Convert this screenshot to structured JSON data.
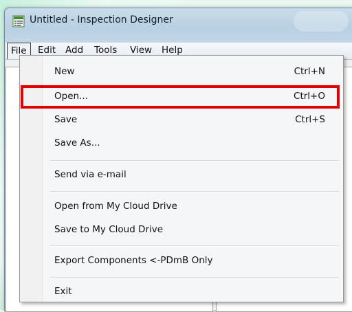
{
  "window": {
    "title": "Untitled - Inspection Designer"
  },
  "menubar": {
    "items": [
      {
        "label": "File",
        "active": true
      },
      {
        "label": "Edit"
      },
      {
        "label": "Add"
      },
      {
        "label": "Tools"
      },
      {
        "label": "View"
      },
      {
        "label": "Help"
      }
    ]
  },
  "file_menu": {
    "items": [
      {
        "label": "New",
        "shortcut": "Ctrl+N"
      },
      {
        "label": "Open...",
        "shortcut": "Ctrl+O",
        "highlighted": true
      },
      {
        "label": "Save",
        "shortcut": "Ctrl+S"
      },
      {
        "label": "Save As..."
      },
      {
        "label": "Send via e-mail"
      },
      {
        "label": "Open from My Cloud Drive"
      },
      {
        "label": "Save to My Cloud Drive"
      },
      {
        "label": "Export Components  <-PDmB Only"
      },
      {
        "label": "Exit"
      }
    ]
  },
  "annotation": {
    "highlight_color": "#e00000",
    "target": "Open..."
  },
  "icons": {
    "app": "app-icon"
  }
}
